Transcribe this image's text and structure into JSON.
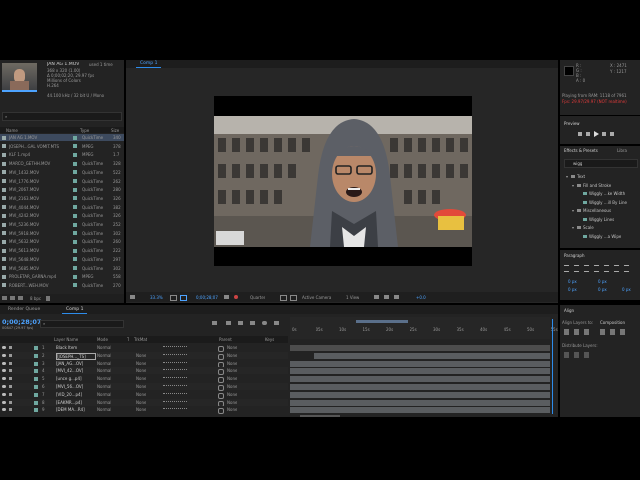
{
  "project": {
    "footage": {
      "name": "JAN AG 1.MOV",
      "used": "used 1 time",
      "lines": [
        "368 x 320 (1.00)",
        "Δ 0;00;02;20, 29.97 fps",
        "Millions of Colors",
        "H.264",
        "44.100 kHz / 32 bit U / Mono"
      ]
    },
    "search_placeholder": "⌕",
    "columns": {
      "name": "Name",
      "type": "Type",
      "size": "Size"
    },
    "items": [
      {
        "name": "JAN AG 1.MOV",
        "type": "QuickTime",
        "size": "340"
      },
      {
        "name": "JOSEPH...GAL VOMIT.MTS",
        "type": "MPEG",
        "size": "378"
      },
      {
        "name": "KLF 1.mp4",
        "type": "MPEG",
        "size": "1.7"
      },
      {
        "name": "MARCO_GETHH.MOV",
        "type": "QuickTime",
        "size": "328"
      },
      {
        "name": "MVI_1432.MOV",
        "type": "QuickTime",
        "size": "522"
      },
      {
        "name": "MVI_1776.MOV",
        "type": "QuickTime",
        "size": "262"
      },
      {
        "name": "MVI_2067.MOV",
        "type": "QuickTime",
        "size": "280"
      },
      {
        "name": "MVI_2163.MOV",
        "type": "QuickTime",
        "size": "326"
      },
      {
        "name": "MVI_4044.MOV",
        "type": "QuickTime",
        "size": "382"
      },
      {
        "name": "MVI_4242.MOV",
        "type": "QuickTime",
        "size": "326"
      },
      {
        "name": "MVI_5236.MOV",
        "type": "QuickTime",
        "size": "252"
      },
      {
        "name": "MVI_5918.MOV",
        "type": "QuickTime",
        "size": "302"
      },
      {
        "name": "MVI_5632.MOV",
        "type": "QuickTime",
        "size": "260"
      },
      {
        "name": "MVI_5613.MOV",
        "type": "QuickTime",
        "size": "222"
      },
      {
        "name": "MVI_5648.MOV",
        "type": "QuickTime",
        "size": "297"
      },
      {
        "name": "MVI_5685.MOV",
        "type": "QuickTime",
        "size": "302"
      },
      {
        "name": "PROLETAR_GARNA.mp4",
        "type": "MPEG",
        "size": "558"
      },
      {
        "name": "ROBERT...WEH.MOV",
        "type": "QuickTime",
        "size": "270"
      }
    ],
    "bpc": "8 bpc"
  },
  "viewer": {
    "tab": "Comp 1",
    "zoom": "33.3%",
    "timecode": "0;00;28;07",
    "resolution": "Quarter",
    "camera": "Active Camera",
    "views": "1 View",
    "offset": "+0.0"
  },
  "info": {
    "x": "X : 2471",
    "y": "Y : 1217",
    "channels": [
      "R :",
      "G :",
      "B :",
      "A : 0"
    ],
    "ram_status": "Playing from RAM: 1118 of 7961",
    "fps_status": "Fps: 29.97/29.97 (NOT realtime)"
  },
  "preview": {
    "title": "Preview"
  },
  "effects": {
    "title": "Effects & Presets",
    "tab2": "Libra",
    "search_value": "wigg",
    "tree": [
      {
        "label": "Text",
        "level": 1
      },
      {
        "label": "Fill and Stroke",
        "level": 2
      },
      {
        "label": "Wiggly ...ke Width",
        "level": 3
      },
      {
        "label": "Wiggly ...ill By Line",
        "level": 3
      },
      {
        "label": "Miscellaneous",
        "level": 2
      },
      {
        "label": "Wiggly Lines",
        "level": 3
      },
      {
        "label": "Scale",
        "level": 2
      },
      {
        "label": "Wiggly ...a Wipe",
        "level": 3
      }
    ]
  },
  "paragraph": {
    "title": "Paragraph",
    "fields": [
      "0 px",
      "0 px",
      "0 px",
      "0 px",
      "0 px"
    ]
  },
  "align": {
    "title": "Align",
    "align_to_label": "Align Layers to:",
    "align_to_value": "Composition",
    "distribute_label": "Distribute Layers:"
  },
  "timeline": {
    "tabs": [
      "Render Queue",
      "Comp 1"
    ],
    "timecode": "0;00;28;07",
    "sub_timecode": "00847 (29.97 fps)",
    "columns": {
      "layer_name": "Layer Name",
      "mode": "Mode",
      "t": "T",
      "trkmat": "TrkMat",
      "parent": "Parent",
      "keys": "Keys"
    },
    "ruler": [
      "0s",
      "05s",
      "10s",
      "15s",
      "20s",
      "25s",
      "30s",
      "35s",
      "40s",
      "45s",
      "50s",
      "55s"
    ],
    "layers": [
      {
        "num": "1",
        "name": "Black Item",
        "mode": "Normal",
        "trkmat": "",
        "parent": "None"
      },
      {
        "num": "2",
        "name": "[JOSEPH..._TS]",
        "mode": "Normal",
        "trkmat": "None",
        "parent": "None"
      },
      {
        "num": "3",
        "name": "[JAN_AG...OV]",
        "mode": "Normal",
        "trkmat": "None",
        "parent": "None"
      },
      {
        "num": "4",
        "name": "[MVI_42...OV]",
        "mode": "Normal",
        "trkmat": "None",
        "parent": "None"
      },
      {
        "num": "5",
        "name": "[unce g...p4]",
        "mode": "Normal",
        "trkmat": "None",
        "parent": "None"
      },
      {
        "num": "6",
        "name": "[MVI_56...OV]",
        "mode": "Normal",
        "trkmat": "None",
        "parent": "None"
      },
      {
        "num": "7",
        "name": "[VID_20...p4]",
        "mode": "Normal",
        "trkmat": "None",
        "parent": "None"
      },
      {
        "num": "8",
        "name": "[EAKMR...p4]",
        "mode": "Normal",
        "trkmat": "None",
        "parent": "None"
      },
      {
        "num": "9",
        "name": "[DEM MA...R4]",
        "mode": "Normal",
        "trkmat": "None",
        "parent": "None"
      }
    ]
  },
  "colors": {
    "accent": "#2d8ceb",
    "panel": "#232323",
    "header": "#1b1b1b",
    "selected": "#3d4a5e",
    "label_teal": "#6fa8a0"
  }
}
